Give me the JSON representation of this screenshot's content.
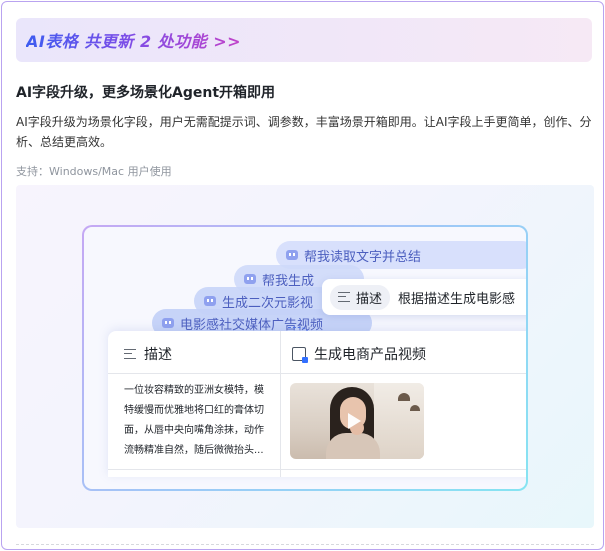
{
  "banner": {
    "text": "AI表格 共更新 2 处功能 >>"
  },
  "feature": {
    "title": "AI字段升级，更多场景化Agent开箱即用",
    "description": "AI字段升级为场景化字段，用户无需配提示词、调参数，丰富场景开箱即用。让AI字段上手更简单，创作、分析、总结更高效。",
    "support": "支持：Windows/Mac 用户使用"
  },
  "illustration": {
    "agent_chips": [
      "帮我读取文字并总结",
      "帮我生成",
      "生成二次元影视",
      "电影感社交媒体广告视频"
    ],
    "description_pill": "描述",
    "description_action": "根据描述生成电影感",
    "table": {
      "columns": [
        "描述",
        "生成电商产品视频"
      ],
      "cell_text": "一位妆容精致的亚洲女模特，模特缓慢而优雅地将口红的膏体切面，从唇中央向嘴角涂抹，动作流畅精准自然，随后微微抬头..."
    }
  },
  "colors": {
    "accent": "#3370ff",
    "border": "#b9a3f0"
  }
}
